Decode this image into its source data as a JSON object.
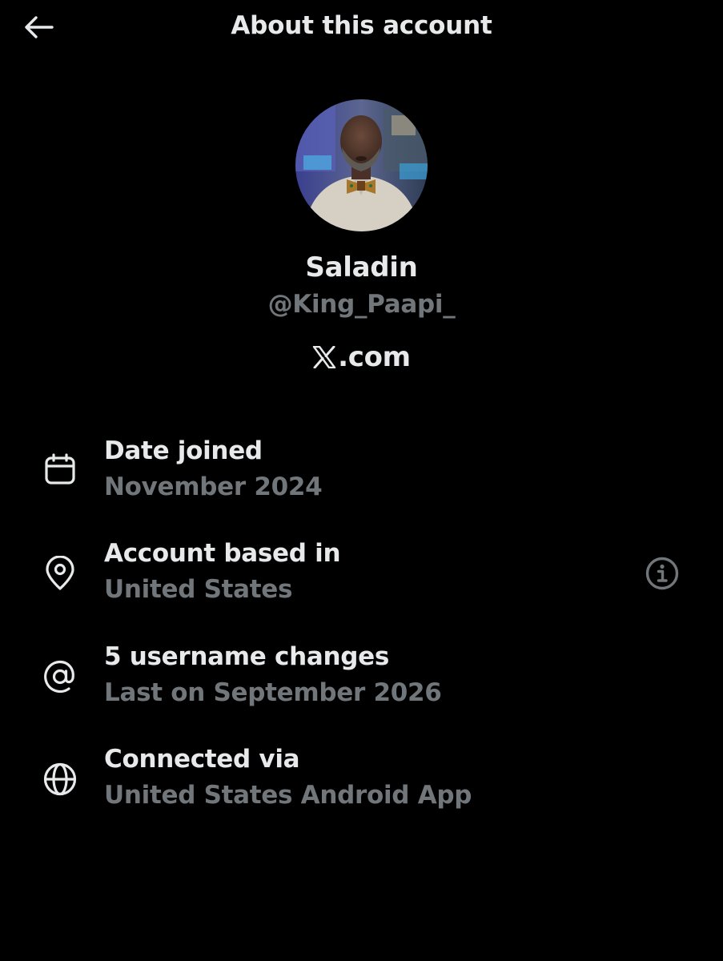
{
  "header": {
    "title": "About this account",
    "back_icon": "arrow-left-icon"
  },
  "profile": {
    "display_name": "Saladin",
    "handle": "@King_Paapi_",
    "site_text": ".com",
    "site_icon": "x-logo-icon"
  },
  "details": [
    {
      "icon": "calendar-icon",
      "label": "Date joined",
      "value": "November 2024"
    },
    {
      "icon": "location-pin-icon",
      "label": "Account based in",
      "value": "United States"
    },
    {
      "icon": "at-sign-icon",
      "label": "5 username changes",
      "value": "Last on September 2026"
    },
    {
      "icon": "globe-icon",
      "label": "Connected via",
      "value": "United States Android App"
    }
  ],
  "info_button_icon": "info-circle-icon",
  "colors": {
    "background": "#000000",
    "primary_text": "#e7e9ea",
    "secondary_text": "#71767b"
  }
}
